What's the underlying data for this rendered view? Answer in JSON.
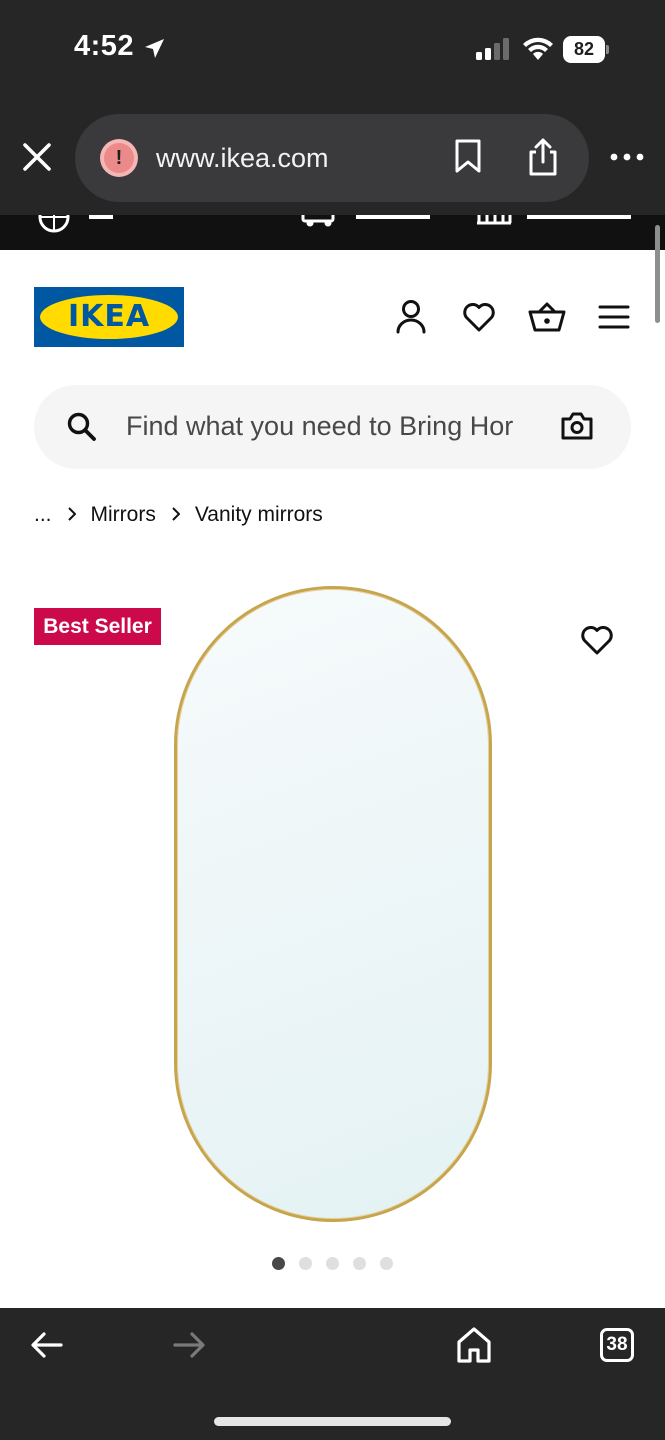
{
  "status_bar": {
    "time": "4:52",
    "battery": "82"
  },
  "browser": {
    "url": "www.ikea.com",
    "tab_count": "38"
  },
  "site": {
    "logo_text": "IKEA",
    "search_placeholder": "Find what you need to Bring Hor",
    "breadcrumb": [
      "...",
      "Mirrors",
      "Vanity mirrors"
    ],
    "badge": "Best Seller",
    "carousel": {
      "total": 5,
      "active_index": 0
    }
  },
  "colors": {
    "ikea_blue": "#0058a3",
    "ikea_yellow": "#ffdb00",
    "badge_red": "#cc0a4b",
    "mirror_frame": "#c7a54f"
  },
  "icons": {
    "close": "close-icon",
    "warning": "warning-icon",
    "bookmark": "bookmark-icon",
    "share": "share-icon",
    "more": "more-icon",
    "account": "account-icon",
    "wishlist": "heart-icon",
    "cart": "basket-icon",
    "menu": "hamburger-icon",
    "search": "search-icon",
    "camera": "camera-icon",
    "back": "back-arrow-icon",
    "forward": "forward-arrow-icon",
    "home": "home-icon"
  }
}
